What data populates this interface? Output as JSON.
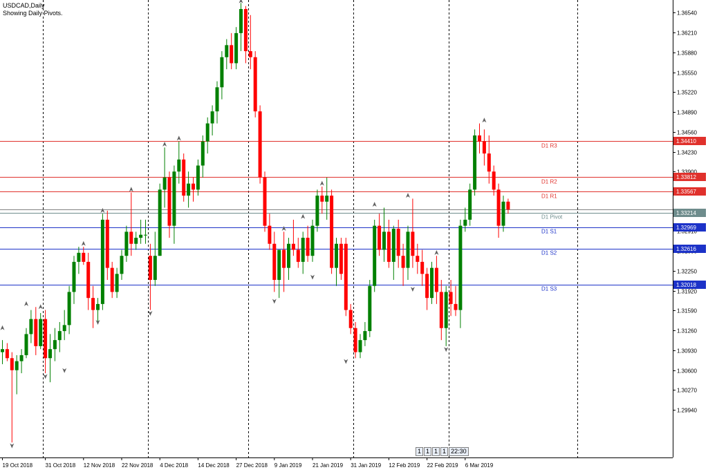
{
  "header": {
    "symbol": "USDCAD,Daily",
    "subtitle": "Showing Daily Pivots."
  },
  "toolbar": {
    "buttons": [
      "1",
      "1",
      "1",
      "1",
      "22:30"
    ]
  },
  "colors": {
    "bull": "#008000",
    "bear": "#ff0000",
    "resistance": "#e0312c",
    "support": "#1c32c8",
    "pivot": "#6e8c8c",
    "grid": "#000000",
    "axis": "#000000"
  },
  "chart_data": {
    "type": "candlestick",
    "y_axis": {
      "range": [
        1.2915,
        1.3675
      ],
      "ticks": [
        "1.36540",
        "1.36210",
        "1.35880",
        "1.35550",
        "1.35220",
        "1.34890",
        "1.34560",
        "1.34230",
        "1.33900",
        "1.33570",
        "1.33240",
        "1.32910",
        "1.32580",
        "1.32250",
        "1.31920",
        "1.31590",
        "1.31260",
        "1.30930",
        "1.30600",
        "1.30270",
        "1.29940"
      ]
    },
    "x_axis": {
      "labels": [
        "19 Oct 2018",
        "31 Oct 2018",
        "12 Nov 2018",
        "22 Nov 2018",
        "4 Dec 2018",
        "14 Dec 2018",
        "27 Dec 2018",
        "9 Jan 2019",
        "21 Jan 2019",
        "31 Jan 2019",
        "12 Feb 2019",
        "22 Feb 2019",
        "6 Mar 2019"
      ],
      "label_index": [
        0,
        9,
        17,
        25,
        33,
        41,
        49,
        57,
        65,
        73,
        81,
        89,
        97
      ]
    },
    "separators_index": [
      8.5,
      30.5,
      51.5,
      73.5,
      93.5,
      120.5
    ],
    "pivot_levels": [
      {
        "name": "D1 R3",
        "value": 1.3441,
        "price_label": "1.34410",
        "kind": "resistance"
      },
      {
        "name": "D1 R2",
        "value": 1.33812,
        "price_label": "1.33812",
        "kind": "resistance"
      },
      {
        "name": "D1 R1",
        "value": 1.33567,
        "price_label": "1.33567",
        "kind": "resistance"
      },
      {
        "name": "D1 Pivot",
        "value": 1.33214,
        "price_label": "1.33214",
        "kind": "pivot"
      },
      {
        "name": "D1 S1",
        "value": 1.32969,
        "price_label": "1.32969",
        "kind": "support"
      },
      {
        "name": "D1 S2",
        "value": 1.32616,
        "price_label": "1.32616",
        "kind": "support"
      },
      {
        "name": "D1 S3",
        "value": 1.32018,
        "price_label": "1.32018",
        "kind": "support"
      }
    ],
    "current_price": 1.3327,
    "candles": [
      [
        1.309,
        1.311,
        1.307,
        1.3095
      ],
      [
        1.3095,
        1.3105,
        1.3075,
        1.308
      ],
      [
        1.308,
        1.309,
        1.294,
        1.306
      ],
      [
        1.306,
        1.3085,
        1.302,
        1.3075
      ],
      [
        1.3075,
        1.3095,
        1.3055,
        1.3085
      ],
      [
        1.3085,
        1.313,
        1.308,
        1.312
      ],
      [
        1.312,
        1.316,
        1.3105,
        1.3145
      ],
      [
        1.3145,
        1.3165,
        1.3085,
        1.31
      ],
      [
        1.31,
        1.3155,
        1.3095,
        1.3145
      ],
      [
        1.3145,
        1.316,
        1.3055,
        1.308
      ],
      [
        1.308,
        1.312,
        1.304,
        1.3095
      ],
      [
        1.3095,
        1.313,
        1.3075,
        1.311
      ],
      [
        1.311,
        1.314,
        1.309,
        1.3125
      ],
      [
        1.3125,
        1.316,
        1.311,
        1.3135
      ],
      [
        1.3135,
        1.32,
        1.312,
        1.319
      ],
      [
        1.319,
        1.325,
        1.317,
        1.324
      ],
      [
        1.324,
        1.3265,
        1.322,
        1.3255
      ],
      [
        1.3255,
        1.3265,
        1.3235,
        1.324
      ],
      [
        1.324,
        1.3255,
        1.316,
        1.318
      ],
      [
        1.318,
        1.32,
        1.313,
        1.316
      ],
      [
        1.316,
        1.318,
        1.314,
        1.317
      ],
      [
        1.317,
        1.332,
        1.316,
        1.331
      ],
      [
        1.331,
        1.3325,
        1.321,
        1.323
      ],
      [
        1.323,
        1.324,
        1.318,
        1.319
      ],
      [
        1.319,
        1.323,
        1.318,
        1.322
      ],
      [
        1.322,
        1.326,
        1.321,
        1.325
      ],
      [
        1.325,
        1.33,
        1.324,
        1.329
      ],
      [
        1.329,
        1.3355,
        1.325,
        1.327
      ],
      [
        1.327,
        1.329,
        1.326,
        1.328
      ],
      [
        1.328,
        1.331,
        1.327,
        1.3285
      ],
      [
        1.3285,
        1.331,
        1.327,
        1.3285
      ],
      [
        1.325,
        1.327,
        1.316,
        1.321
      ],
      [
        1.321,
        1.329,
        1.32,
        1.325
      ],
      [
        1.325,
        1.337,
        1.325,
        1.336
      ],
      [
        1.336,
        1.343,
        1.333,
        1.338
      ],
      [
        1.338,
        1.339,
        1.328,
        1.33
      ],
      [
        1.33,
        1.34,
        1.327,
        1.339
      ],
      [
        1.339,
        1.344,
        1.337,
        1.341
      ],
      [
        1.341,
        1.342,
        1.334,
        1.335
      ],
      [
        1.335,
        1.339,
        1.333,
        1.337
      ],
      [
        1.337,
        1.338,
        1.334,
        1.336
      ],
      [
        1.336,
        1.341,
        1.335,
        1.34
      ],
      [
        1.34,
        1.345,
        1.338,
        1.344
      ],
      [
        1.344,
        1.348,
        1.342,
        1.347
      ],
      [
        1.347,
        1.35,
        1.345,
        1.349
      ],
      [
        1.349,
        1.354,
        1.347,
        1.353
      ],
      [
        1.353,
        1.359,
        1.351,
        1.358
      ],
      [
        1.358,
        1.361,
        1.356,
        1.36
      ],
      [
        1.36,
        1.362,
        1.356,
        1.357
      ],
      [
        1.357,
        1.363,
        1.356,
        1.362
      ],
      [
        1.362,
        1.367,
        1.359,
        1.366
      ],
      [
        1.366,
        1.3665,
        1.357,
        1.359
      ],
      [
        1.359,
        1.365,
        1.356,
        1.358
      ],
      [
        1.358,
        1.359,
        1.348,
        1.349
      ],
      [
        1.349,
        1.35,
        1.337,
        1.338
      ],
      [
        1.338,
        1.339,
        1.329,
        1.33
      ],
      [
        1.33,
        1.332,
        1.326,
        1.327
      ],
      [
        1.327,
        1.329,
        1.319,
        1.321
      ],
      [
        1.321,
        1.326,
        1.318,
        1.326
      ],
      [
        1.326,
        1.329,
        1.319,
        1.323
      ],
      [
        1.323,
        1.328,
        1.321,
        1.327
      ],
      [
        1.327,
        1.331,
        1.325,
        1.326
      ],
      [
        1.326,
        1.328,
        1.323,
        1.324
      ],
      [
        1.324,
        1.329,
        1.322,
        1.328
      ],
      [
        1.328,
        1.33,
        1.324,
        1.325
      ],
      [
        1.325,
        1.331,
        1.324,
        1.33
      ],
      [
        1.33,
        1.336,
        1.329,
        1.335
      ],
      [
        1.335,
        1.3365,
        1.332,
        1.334
      ],
      [
        1.334,
        1.338,
        1.331,
        1.335
      ],
      [
        1.335,
        1.336,
        1.322,
        1.323
      ],
      [
        1.323,
        1.328,
        1.32,
        1.327
      ],
      [
        1.327,
        1.328,
        1.321,
        1.322
      ],
      [
        1.327,
        1.328,
        1.315,
        1.316
      ],
      [
        1.316,
        1.317,
        1.312,
        1.313
      ],
      [
        1.313,
        1.314,
        1.308,
        1.309
      ],
      [
        1.309,
        1.312,
        1.308,
        1.311
      ],
      [
        1.311,
        1.314,
        1.31,
        1.3125
      ],
      [
        1.3125,
        1.321,
        1.3115,
        1.32
      ],
      [
        1.32,
        1.331,
        1.319,
        1.33
      ],
      [
        1.33,
        1.332,
        1.325,
        1.326
      ],
      [
        1.326,
        1.333,
        1.324,
        1.329
      ],
      [
        1.329,
        1.331,
        1.323,
        1.324
      ],
      [
        1.324,
        1.33,
        1.321,
        1.3295
      ],
      [
        1.3295,
        1.331,
        1.323,
        1.325
      ],
      [
        1.325,
        1.327,
        1.32,
        1.323
      ],
      [
        1.323,
        1.33,
        1.321,
        1.329
      ],
      [
        1.329,
        1.3345,
        1.323,
        1.325
      ],
      [
        1.325,
        1.327,
        1.322,
        1.324
      ],
      [
        1.324,
        1.326,
        1.32,
        1.322
      ],
      [
        1.322,
        1.323,
        1.316,
        1.318
      ],
      [
        1.318,
        1.324,
        1.317,
        1.323
      ],
      [
        1.323,
        1.325,
        1.317,
        1.319
      ],
      [
        1.319,
        1.321,
        1.311,
        1.313
      ],
      [
        1.313,
        1.32,
        1.31,
        1.319
      ],
      [
        1.319,
        1.321,
        1.315,
        1.317
      ],
      [
        1.317,
        1.32,
        1.315,
        1.316
      ],
      [
        1.316,
        1.331,
        1.313,
        1.33
      ],
      [
        1.33,
        1.333,
        1.329,
        1.331
      ],
      [
        1.331,
        1.337,
        1.33,
        1.336
      ],
      [
        1.336,
        1.346,
        1.335,
        1.345
      ],
      [
        1.345,
        1.347,
        1.342,
        1.344
      ],
      [
        1.344,
        1.346,
        1.34,
        1.342
      ],
      [
        1.342,
        1.345,
        1.337,
        1.339
      ],
      [
        1.339,
        1.34,
        1.335,
        1.336
      ],
      [
        1.336,
        1.337,
        1.328,
        1.33
      ],
      [
        1.33,
        1.335,
        1.329,
        1.334
      ],
      [
        1.334,
        1.3345,
        1.332,
        1.3327
      ]
    ],
    "fractals": [
      {
        "i": 0,
        "dir": "up",
        "price": 1.313
      },
      {
        "i": 2,
        "dir": "down",
        "price": 1.2935
      },
      {
        "i": 5,
        "dir": "up",
        "price": 1.317
      },
      {
        "i": 8,
        "dir": "up",
        "price": 1.3165
      },
      {
        "i": 9,
        "dir": "down",
        "price": 1.305
      },
      {
        "i": 13,
        "dir": "down",
        "price": 1.306
      },
      {
        "i": 17,
        "dir": "up",
        "price": 1.327
      },
      {
        "i": 20,
        "dir": "down",
        "price": 1.314
      },
      {
        "i": 21,
        "dir": "up",
        "price": 1.3325
      },
      {
        "i": 27,
        "dir": "up",
        "price": 1.336
      },
      {
        "i": 31,
        "dir": "down",
        "price": 1.3155
      },
      {
        "i": 34,
        "dir": "up",
        "price": 1.3435
      },
      {
        "i": 37,
        "dir": "up",
        "price": 1.3445
      },
      {
        "i": 50,
        "dir": "up",
        "price": 1.3673
      },
      {
        "i": 57,
        "dir": "down",
        "price": 1.3175
      },
      {
        "i": 59,
        "dir": "up",
        "price": 1.3295
      },
      {
        "i": 63,
        "dir": "up",
        "price": 1.3315
      },
      {
        "i": 65,
        "dir": "down",
        "price": 1.3215
      },
      {
        "i": 67,
        "dir": "up",
        "price": 1.337
      },
      {
        "i": 72,
        "dir": "down",
        "price": 1.3075
      },
      {
        "i": 78,
        "dir": "up",
        "price": 1.3335
      },
      {
        "i": 85,
        "dir": "up",
        "price": 1.335
      },
      {
        "i": 86,
        "dir": "down",
        "price": 1.3195
      },
      {
        "i": 91,
        "dir": "up",
        "price": 1.3255
      },
      {
        "i": 93,
        "dir": "down",
        "price": 1.3095
      },
      {
        "i": 101,
        "dir": "up",
        "price": 1.3475
      }
    ]
  }
}
